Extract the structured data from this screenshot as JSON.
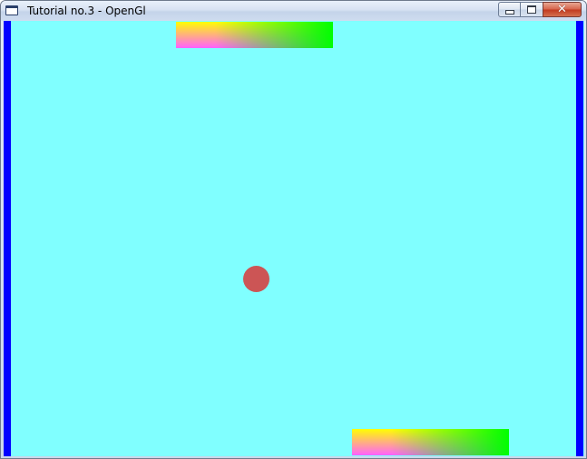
{
  "window": {
    "title": "Tutorial no.3 - OpenGl",
    "buttons": {
      "minimize": "minimize",
      "maximize": "maximize",
      "close": "✕"
    }
  },
  "scene": {
    "background_color": "#80ffff",
    "wall_color": "#0000ff",
    "ball_color": "#cc5555",
    "paddle_gradient": [
      "#ffff00",
      "#ff60ff",
      "#00ff00"
    ]
  }
}
